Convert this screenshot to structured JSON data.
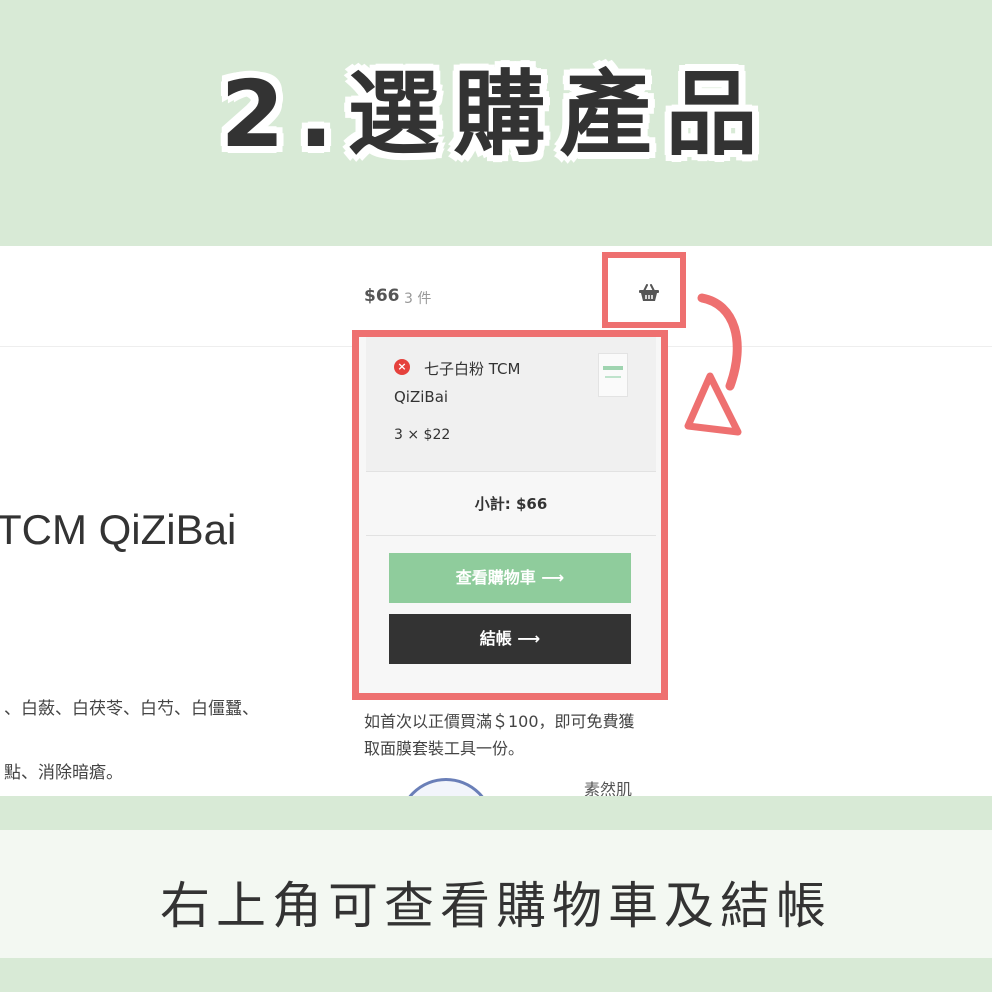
{
  "heading": "2.選購產品",
  "header": {
    "cart_total": "$66",
    "item_count": "3 件",
    "cart_icon": "basket-icon"
  },
  "product": {
    "title": "TCM QiZiBai",
    "ingredients_line": "、白蘞、白茯苓、白芍、白僵蠶、",
    "effect_line": "點、消除暗瘡。"
  },
  "mini_cart": {
    "item": {
      "remove_icon": "remove-icon",
      "remove_glyph": "×",
      "name_line1": "七子白粉 TCM",
      "name_line2": "QiZiBai",
      "qty_price": "3 × $22"
    },
    "subtotal": "小計: $66",
    "view_cart_label": "查看購物車 ⟶",
    "checkout_label": "結帳 ⟶"
  },
  "promo": {
    "text_line1": "如首次以正價買滿＄100，即可免費獲",
    "text_line2": "取面膜套裝工具一份。"
  },
  "brand_text": "素然肌",
  "caption": "右上角可查看購物車及結帳",
  "colors": {
    "background": "#d8ead6",
    "highlight": "#ee7070",
    "view_cart_button": "#8fcc9c",
    "checkout_button": "#333333",
    "remove_icon": "#e5413c"
  }
}
